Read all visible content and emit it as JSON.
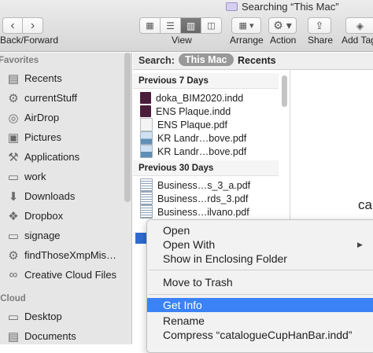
{
  "window": {
    "title": "Searching “This Mac”"
  },
  "toolbar": {
    "back_forward_label": "Back/Forward",
    "view_label": "View",
    "arrange_label": "Arrange",
    "action_label": "Action",
    "share_label": "Share",
    "add_tags_label": "Add Tag"
  },
  "sidebar": {
    "favorites_header": "Favorites",
    "icloud_header": "iCloud",
    "items": [
      {
        "label": "Recents",
        "icon": "recents-icon",
        "glyph": "▤"
      },
      {
        "label": "currentStuff",
        "icon": "gear-folder-icon",
        "glyph": "⚙"
      },
      {
        "label": "AirDrop",
        "icon": "airdrop-icon",
        "glyph": "◎"
      },
      {
        "label": "Pictures",
        "icon": "camera-icon",
        "glyph": "▣"
      },
      {
        "label": "Applications",
        "icon": "applications-icon",
        "glyph": "⚒"
      },
      {
        "label": "work",
        "icon": "folder-icon",
        "glyph": "▭"
      },
      {
        "label": "Downloads",
        "icon": "downloads-icon",
        "glyph": "⬇"
      },
      {
        "label": "Dropbox",
        "icon": "dropbox-icon",
        "glyph": "❖"
      },
      {
        "label": "signage",
        "icon": "folder-icon",
        "glyph": "▭"
      },
      {
        "label": "findThoseXmpMis…",
        "icon": "gear-folder-icon",
        "glyph": "⚙"
      },
      {
        "label": "Creative Cloud Files",
        "icon": "creative-cloud-icon",
        "glyph": "∞"
      }
    ],
    "icloud_items": [
      {
        "label": "Desktop",
        "icon": "desktop-icon",
        "glyph": "▭"
      },
      {
        "label": "Documents",
        "icon": "documents-icon",
        "glyph": "▤"
      }
    ]
  },
  "search": {
    "label": "Search:",
    "scope_this_mac": "This Mac",
    "scope_recents": "Recents"
  },
  "results": {
    "groups": [
      {
        "header": "Previous 7 Days",
        "files": [
          {
            "name": "doka_BIM2020.indd",
            "kind": "indd"
          },
          {
            "name": "ENS Plaque.indd",
            "kind": "indd"
          },
          {
            "name": "ENS Plaque.pdf",
            "kind": "pdf"
          },
          {
            "name": "KR Landr…bove.pdf",
            "kind": "img"
          },
          {
            "name": "KR Landr…bove.pdf",
            "kind": "img"
          }
        ]
      },
      {
        "header": "Previous 30 Days",
        "files": [
          {
            "name": "Business…s_3_a.pdf",
            "kind": "doc"
          },
          {
            "name": "Business…rds_3.pdf",
            "kind": "doc"
          },
          {
            "name": "Business…ilvano.pdf",
            "kind": "doc"
          }
        ]
      }
    ]
  },
  "preview": {
    "text": "ca"
  },
  "context_menu": {
    "items": [
      {
        "label": "Open"
      },
      {
        "label": "Open With",
        "has_submenu": true
      },
      {
        "label": "Show in Enclosing Folder"
      },
      {
        "label": "Move to Trash"
      },
      {
        "label": "Get Info",
        "highlighted": true
      },
      {
        "label": "Rename"
      },
      {
        "label": "Compress “catalogueCupHanBar.indd”"
      }
    ],
    "submenu_arrow": "▶"
  },
  "colors": {
    "highlight": "#3b82f6",
    "sidebar_bg": "#e6e6e6",
    "toolbar_bg": "#dcdcdc"
  }
}
